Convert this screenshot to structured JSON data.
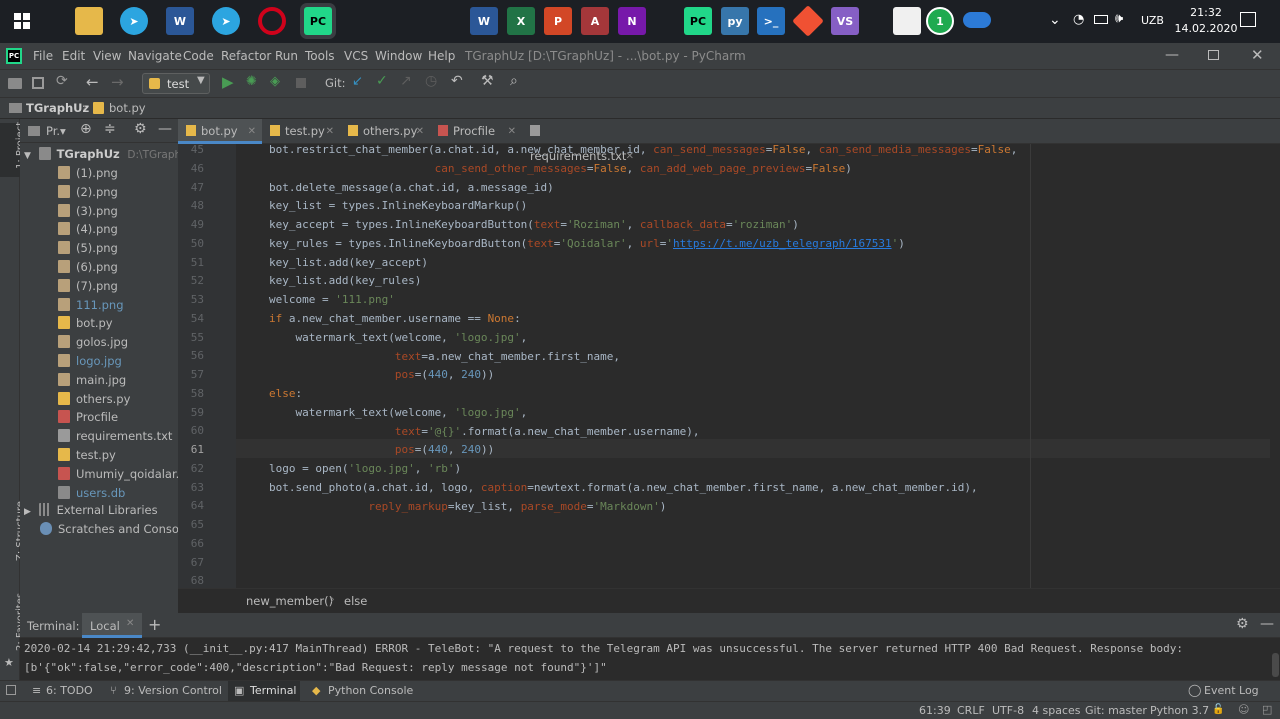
{
  "taskbar": {
    "time": "21:32",
    "date": "14.02.2020",
    "lang": "UZB"
  },
  "window": {
    "title": "TGraphUz [D:\\TGraphUz] - ...\\bot.py - PyCharm"
  },
  "menu": [
    "File",
    "Edit",
    "View",
    "Navigate",
    "Code",
    "Refactor",
    "Run",
    "Tools",
    "VCS",
    "Window",
    "Help"
  ],
  "toolbar": {
    "run_config": "test",
    "git_label": "Git:"
  },
  "nav": {
    "project": "TGraphUz",
    "file": "bot.py"
  },
  "project_panel": {
    "title": "Pr.▾",
    "root": "TGraphUz",
    "root_path": "D:\\TGraphUz",
    "files": [
      {
        "name": "(1).png",
        "kind": "img"
      },
      {
        "name": "(2).png",
        "kind": "img"
      },
      {
        "name": "(3).png",
        "kind": "img"
      },
      {
        "name": "(4).png",
        "kind": "img"
      },
      {
        "name": "(5).png",
        "kind": "img"
      },
      {
        "name": "(6).png",
        "kind": "img"
      },
      {
        "name": "(7).png",
        "kind": "img"
      },
      {
        "name": "111.png",
        "kind": "img-blue"
      },
      {
        "name": "bot.py",
        "kind": "py"
      },
      {
        "name": "golos.jpg",
        "kind": "img"
      },
      {
        "name": "logo.jpg",
        "kind": "img-blue"
      },
      {
        "name": "main.jpg",
        "kind": "img"
      },
      {
        "name": "others.py",
        "kind": "py"
      },
      {
        "name": "Procfile",
        "kind": "proc"
      },
      {
        "name": "requirements.txt",
        "kind": "txt"
      },
      {
        "name": "test.py",
        "kind": "py"
      },
      {
        "name": "Umumiy_qoidalar.pd",
        "kind": "pdf"
      },
      {
        "name": "users.db",
        "kind": "db-blue"
      }
    ],
    "external": "External Libraries",
    "scratches": "Scratches and Consoles"
  },
  "left_tools": {
    "project": "1: Project",
    "structure": "Z: Structure",
    "favorites": "2: Favorites"
  },
  "tabs": [
    {
      "label": "bot.py",
      "active": true
    },
    {
      "label": "test.py",
      "active": false
    },
    {
      "label": "others.py",
      "active": false
    },
    {
      "label": "Procfile",
      "active": false
    },
    {
      "label": "requirements.txt",
      "active": false
    }
  ],
  "code": {
    "line_numbers": [
      "45",
      "46",
      "47",
      "48",
      "49",
      "50",
      "51",
      "52",
      "53",
      "54",
      "55",
      "56",
      "57",
      "58",
      "59",
      "60",
      "61",
      "62",
      "63",
      "64",
      "65",
      "66",
      "67",
      "68"
    ]
  },
  "breadcrumb": {
    "func": "new_member()",
    "branch": "else"
  },
  "terminal": {
    "label": "Terminal:",
    "tab": "Local",
    "add": "+",
    "line1": "2020-02-14 21:29:42,733 (__init__.py:417 MainThread) ERROR - TeleBot: \"A request to the Telegram API was unsuccessful. The server returned HTTP 400 Bad Request. Response body:",
    "line2": "[b'{\"ok\":false,\"error_code\":400,\"description\":\"Bad Request: reply message not found\"}']\""
  },
  "bottom_tools": {
    "todo": "6: TODO",
    "vc": "9: Version Control",
    "terminal": "Terminal",
    "console": "Python Console",
    "eventlog": "Event Log"
  },
  "status": {
    "pos": "61:39",
    "crlf": "CRLF",
    "enc": "UTF-8",
    "indent": "4 spaces",
    "git": "Git: master",
    "python": "Python 3.7"
  }
}
